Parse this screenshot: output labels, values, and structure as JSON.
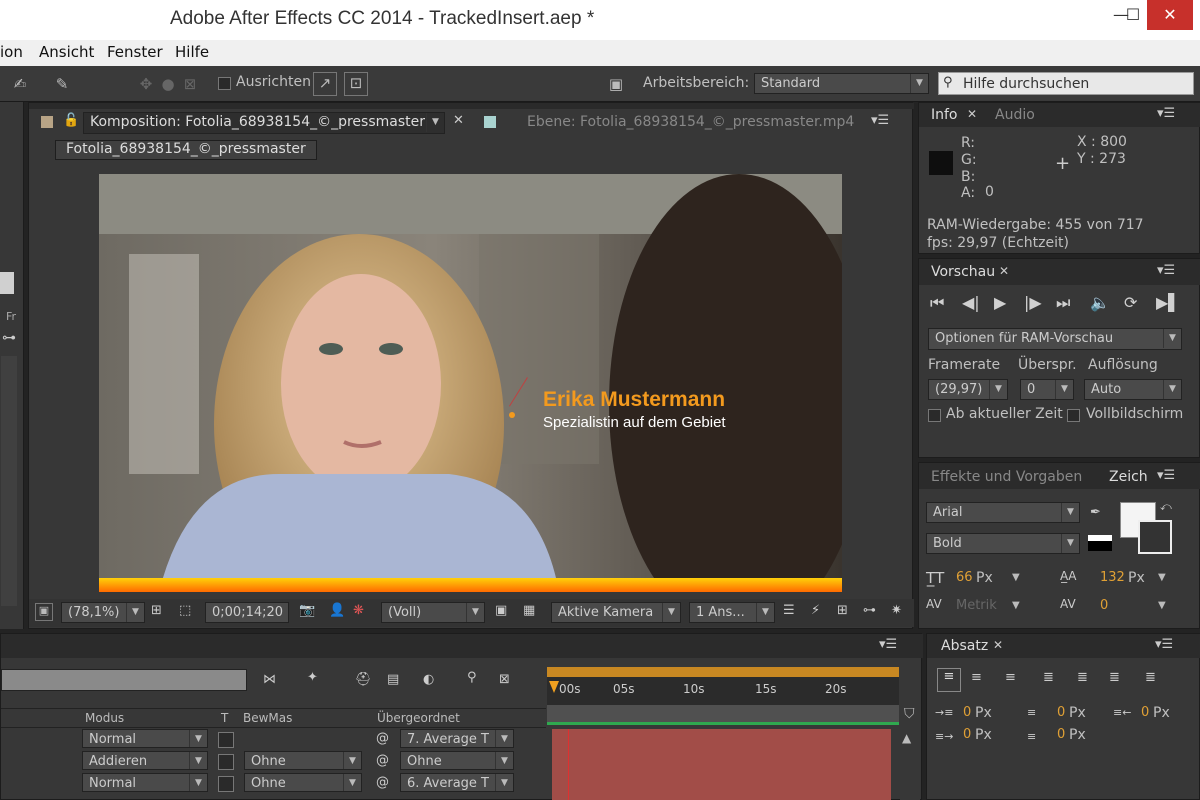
{
  "app": {
    "title": "Adobe After Effects CC 2014 - TrackedInsert.aep *"
  },
  "window_controls": {
    "minimize": "—",
    "maximize": "☐",
    "close": "✕"
  },
  "menu": [
    "ion",
    "Ansicht",
    "Fenster",
    "Hilfe"
  ],
  "toolbar": {
    "align_label": "Ausrichten",
    "workspace_label": "Arbeitsbereich:",
    "workspace_value": "Standard",
    "search_placeholder": "Hilfe durchsuchen"
  },
  "comp_panel": {
    "tab_label": "Komposition: Fotolia_68938154_©_pressmaster",
    "layer_tab_label": "Ebene: Fotolia_68938154_©_pressmaster.mp4",
    "breadcrumb": "Fotolia_68938154_©_pressmaster"
  },
  "viewer": {
    "lower_third_name": "Erika Mustermann",
    "lower_third_subtitle": "Spezialistin auf dem Gebiet",
    "accent": "#f39a1e"
  },
  "viewer_footer": {
    "zoom": "(78,1%)",
    "timecode": "0;00;14;20",
    "resolution": "(Voll)",
    "camera": "Aktive Kamera",
    "views": "1 Ans..."
  },
  "info_panel": {
    "tab_info": "Info",
    "tab_audio": "Audio",
    "r": "R:",
    "g": "G:",
    "b": "B:",
    "a": "A:",
    "a_value": "0",
    "x": "X : 800",
    "y": "Y : 273",
    "ram_playback": "RAM-Wiedergabe: 455 von 717",
    "fps": "fps: 29,97 (Echtzeit)"
  },
  "preview_panel": {
    "tab": "Vorschau",
    "options": "Optionen für RAM-Vorschau",
    "framerate_label": "Framerate",
    "skip_label": "Überspr.",
    "resolution_label": "Auflösung",
    "framerate_value": "(29,97)",
    "skip_value": "0",
    "resolution_value": "Auto",
    "from_current": "Ab aktueller Zeit",
    "fullscreen": "Vollbildschirm"
  },
  "char_panel": {
    "tab_effects": "Effekte und Vorgaben",
    "tab_char": "Zeich",
    "font": "Arial",
    "style": "Bold",
    "size": "66",
    "size_unit": "Px",
    "leading": "132",
    "leading_unit": "Px",
    "kerning": "Metrik",
    "tracking": "0"
  },
  "para_panel": {
    "tab": "Absatz",
    "indent1": "0",
    "indent2": "0",
    "indent3": "0",
    "space1": "0",
    "space2": "0",
    "unit": "Px"
  },
  "timeline": {
    "col_mode": "Modus",
    "col_t": "T",
    "col_bewmas": "BewMas",
    "col_parent": "Übergeordnet",
    "ruler": [
      "00s",
      "05s",
      "10s",
      "15s",
      "20s"
    ],
    "rows": [
      {
        "mode": "Normal",
        "bewmas": "",
        "parent": "7. Average T"
      },
      {
        "mode": "Addieren",
        "bewmas": "Ohne",
        "parent": "Ohne"
      },
      {
        "mode": "Normal",
        "bewmas": "Ohne",
        "parent": "6. Average T"
      }
    ]
  }
}
